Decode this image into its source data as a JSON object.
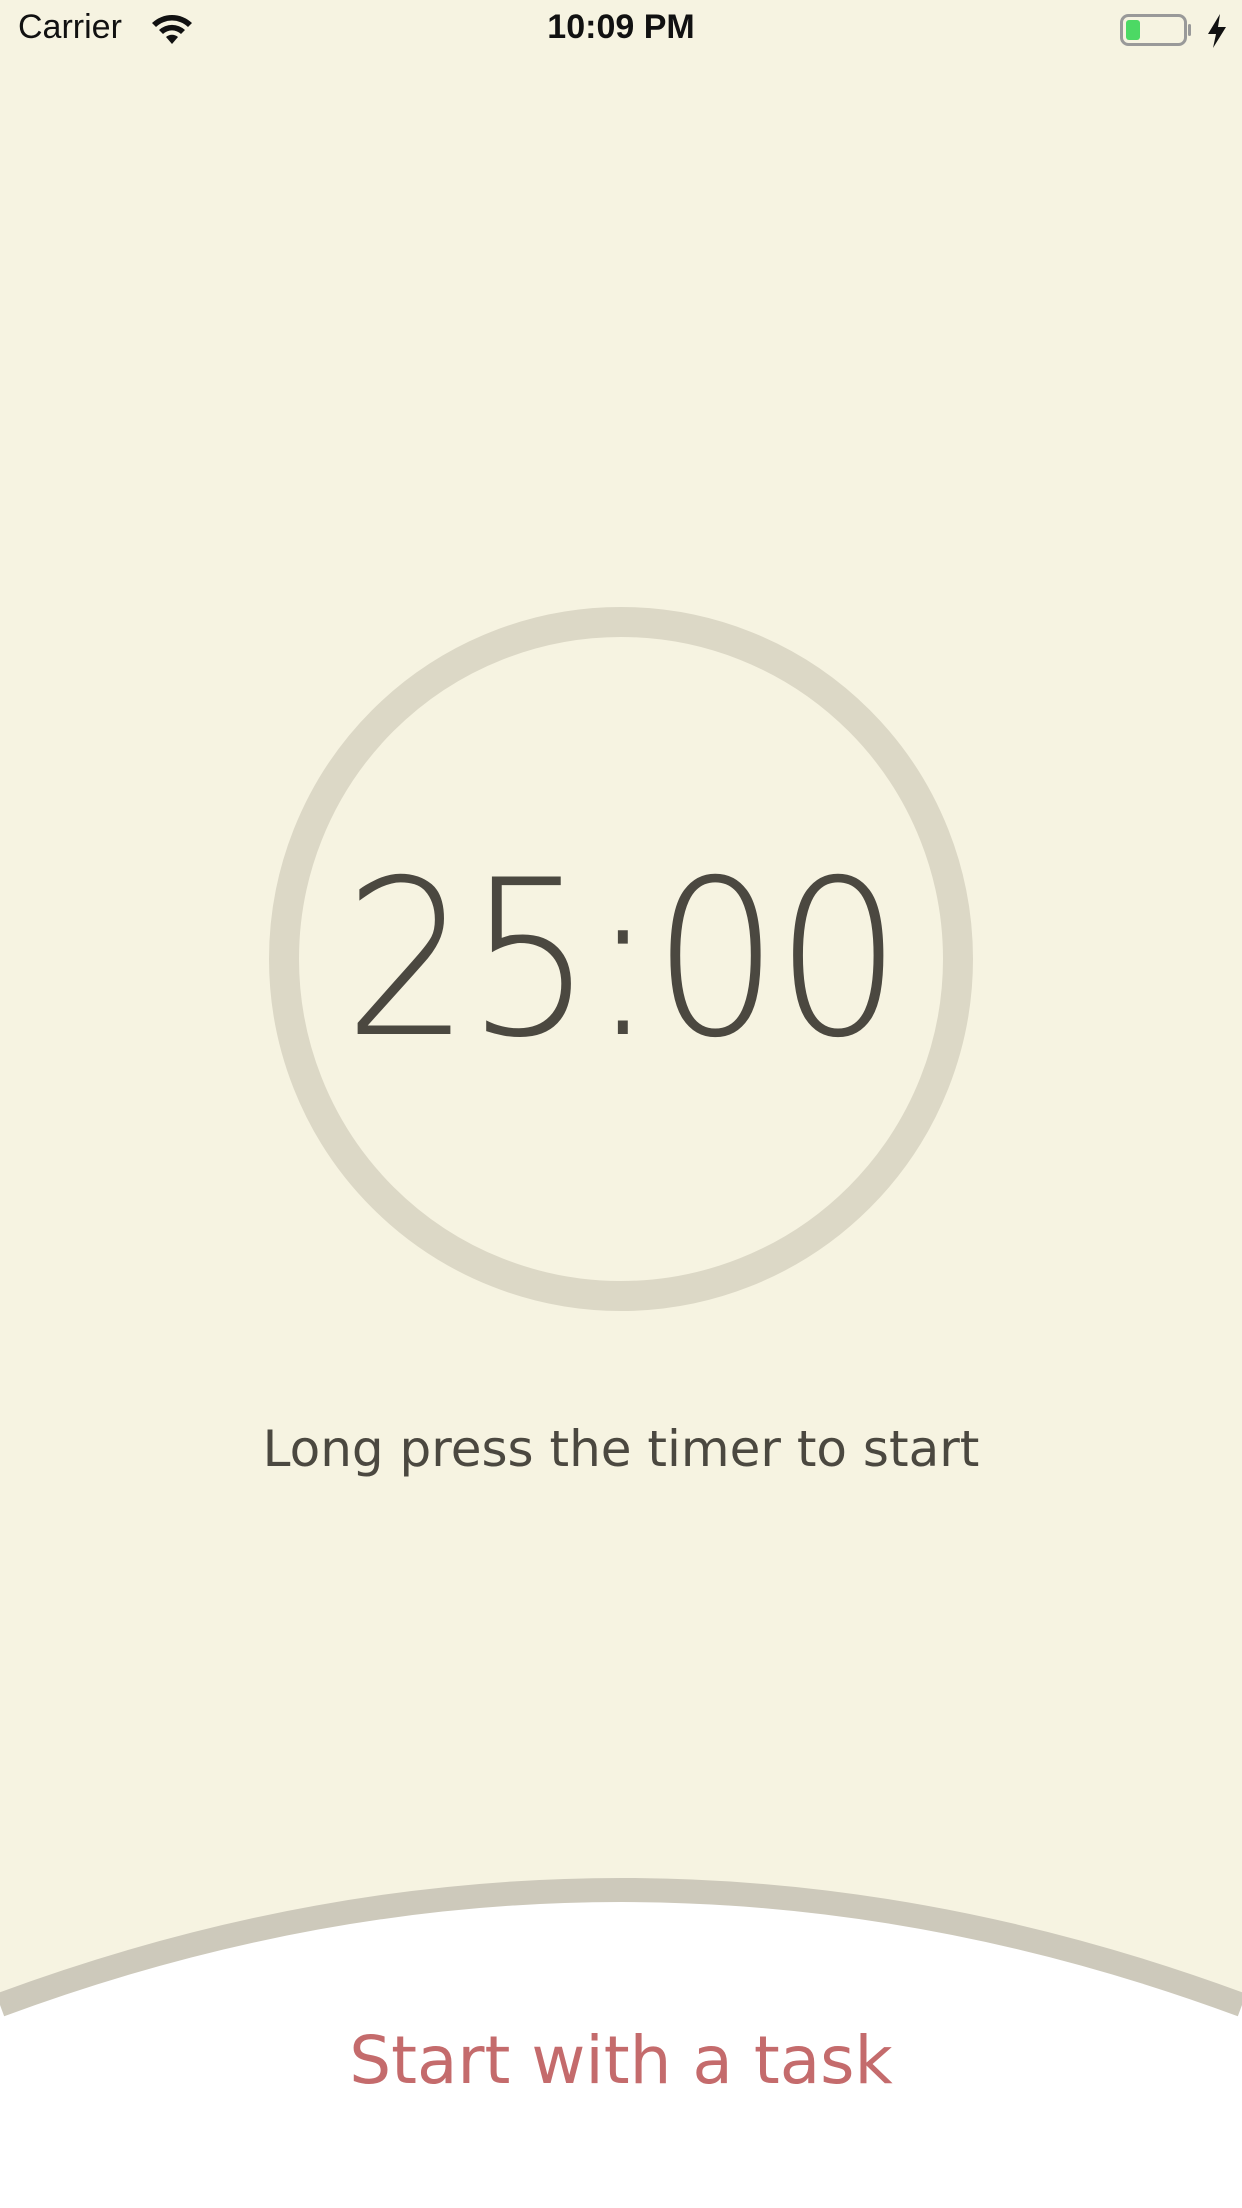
{
  "status_bar": {
    "carrier": "Carrier",
    "time": "10:09 PM",
    "wifi_icon": "wifi-icon",
    "battery_icon": "battery-icon",
    "charging_icon": "charging-bolt-icon",
    "battery_color": "#4cd964"
  },
  "timer": {
    "display": "25:00",
    "ring_color": "#dcd8c6"
  },
  "hint": "Long press the timer to start",
  "task": {
    "label": "Start with a task",
    "color": "#c46b6c",
    "curve_color": "#cdc9bb"
  },
  "colors": {
    "background": "#f6f3e1",
    "text": "#4b4840",
    "panel": "#ffffff"
  }
}
